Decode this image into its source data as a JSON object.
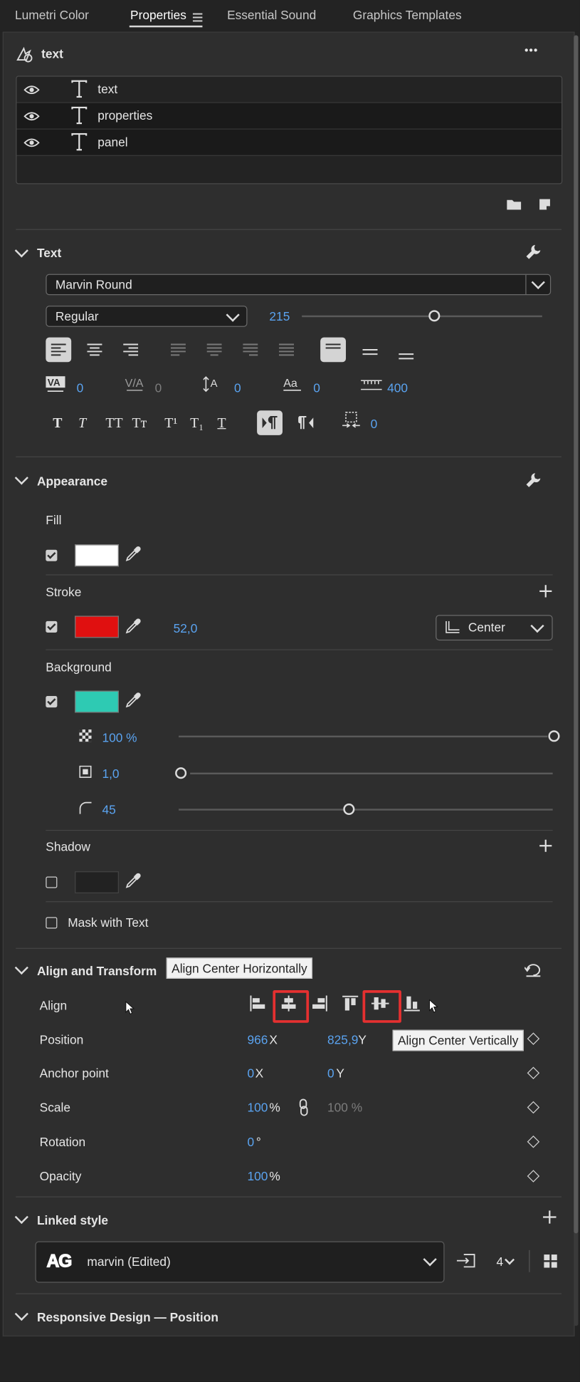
{
  "tabs": [
    {
      "label": "Lumetri Color"
    },
    {
      "label": "Properties"
    },
    {
      "label": "Essential Sound"
    },
    {
      "label": "Graphics Templates"
    }
  ],
  "header": {
    "title": "text",
    "more": "•••"
  },
  "layers": [
    {
      "label": "text"
    },
    {
      "label": "properties"
    },
    {
      "label": "panel"
    }
  ],
  "text_section": {
    "title": "Text",
    "font": "Marvin Round",
    "style": "Regular",
    "size": "215",
    "kerning": "0",
    "tracking": "0",
    "leading": "0",
    "baseline": "0",
    "tab_width": "400",
    "tsume": "0",
    "format_labels": [
      "T",
      "T",
      "TT",
      "Tт",
      "T¹",
      "T₁",
      "T"
    ]
  },
  "appearance": {
    "title": "Appearance",
    "fill_label": "Fill",
    "stroke_label": "Stroke",
    "stroke_width": "52,0",
    "stroke_position": "Center",
    "background_label": "Background",
    "bg_opacity": "100 %",
    "bg_size": "1,0",
    "bg_corner": "45",
    "shadow_label": "Shadow",
    "mask_label": "Mask with Text",
    "colors": {
      "fill": "#ffffff",
      "stroke": "#e01010",
      "background": "#2ecab3",
      "shadow": "#222222"
    }
  },
  "align_transform": {
    "title": "Align and Transform",
    "align_label": "Align",
    "tooltip_h": "Align Center Horizontally",
    "tooltip_v": "Align Center Vertically",
    "position_label": "Position",
    "position_x": "966",
    "position_y": "825,9",
    "anchor_label": "Anchor point",
    "anchor_x": "0",
    "anchor_y": "0",
    "scale_label": "Scale",
    "scale": "100",
    "scale_linked": "100 %",
    "rotation_label": "Rotation",
    "rotation": "0",
    "opacity_label": "Opacity",
    "opacity": "100",
    "x": "X",
    "y": "Y",
    "pct": "%",
    "deg": "°"
  },
  "linked_style": {
    "title": "Linked style",
    "logo": "AG",
    "name": "marvin (Edited)",
    "count": "4"
  },
  "responsive": {
    "title": "Responsive Design — Position"
  }
}
